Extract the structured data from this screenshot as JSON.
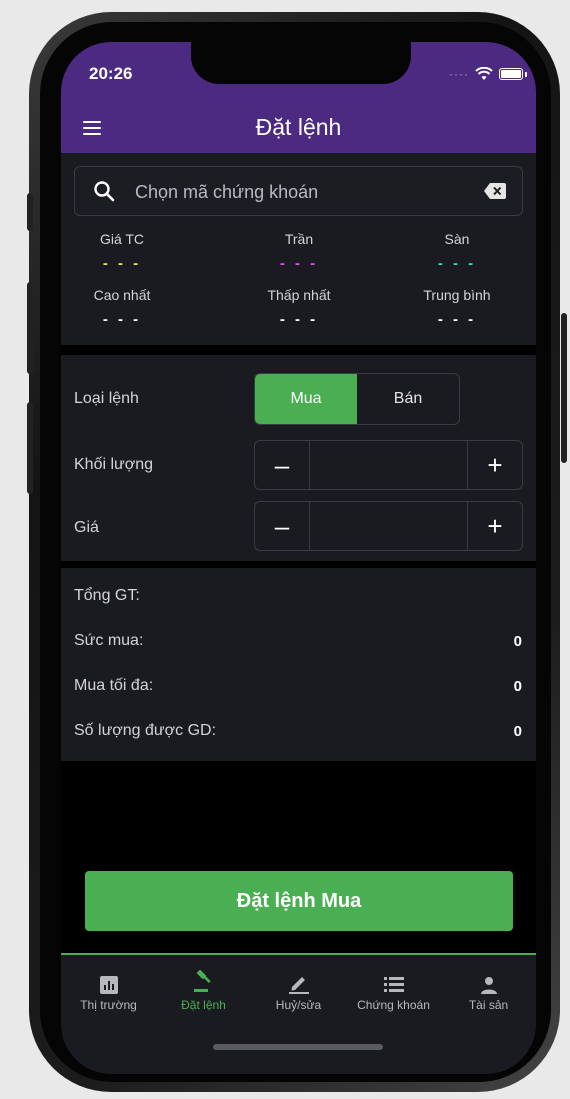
{
  "status": {
    "time": "20:26"
  },
  "header": {
    "title": "Đặt lệnh"
  },
  "search": {
    "placeholder": "Chọn mã chứng khoán"
  },
  "stats": [
    {
      "label": "Giá TC",
      "value": "- - -",
      "color": "#f0e15a"
    },
    {
      "label": "Trần",
      "value": "- - -",
      "color": "#e44ff2"
    },
    {
      "label": "Sàn",
      "value": "- - -",
      "color": "#33d9c4"
    },
    {
      "label": "Cao nhất",
      "value": "- - -",
      "color": "#ffffff"
    },
    {
      "label": "Thấp nhất",
      "value": "- - -",
      "color": "#ffffff"
    },
    {
      "label": "Trung bình",
      "value": "- - -",
      "color": "#ffffff"
    }
  ],
  "order": {
    "type_label": "Loại lệnh",
    "buy_label": "Mua",
    "sell_label": "Bán",
    "volume_label": "Khối lượng",
    "price_label": "Giá",
    "minus": "–",
    "plus": "+"
  },
  "summary": {
    "total_label": "Tổng GT:",
    "total_value": "",
    "buying_power_label": "Sức mua:",
    "buying_power_value": "0",
    "max_buy_label": "Mua tối đa:",
    "max_buy_value": "0",
    "tradable_label": "Số lượng được GD:",
    "tradable_value": "0"
  },
  "submit_label": "Đặt lệnh Mua",
  "tabs": [
    {
      "label": "Thị trường",
      "icon": "chart-icon"
    },
    {
      "label": "Đặt lệnh",
      "icon": "gavel-icon",
      "active": true
    },
    {
      "label": "Huỷ/sửa",
      "icon": "pencil-icon"
    },
    {
      "label": "Chứng khoán",
      "icon": "list-icon"
    },
    {
      "label": "Tài sản",
      "icon": "person-icon"
    }
  ],
  "colors": {
    "accent": "#4aaf52",
    "header": "#4d2a82",
    "panel": "#1a1b20"
  }
}
